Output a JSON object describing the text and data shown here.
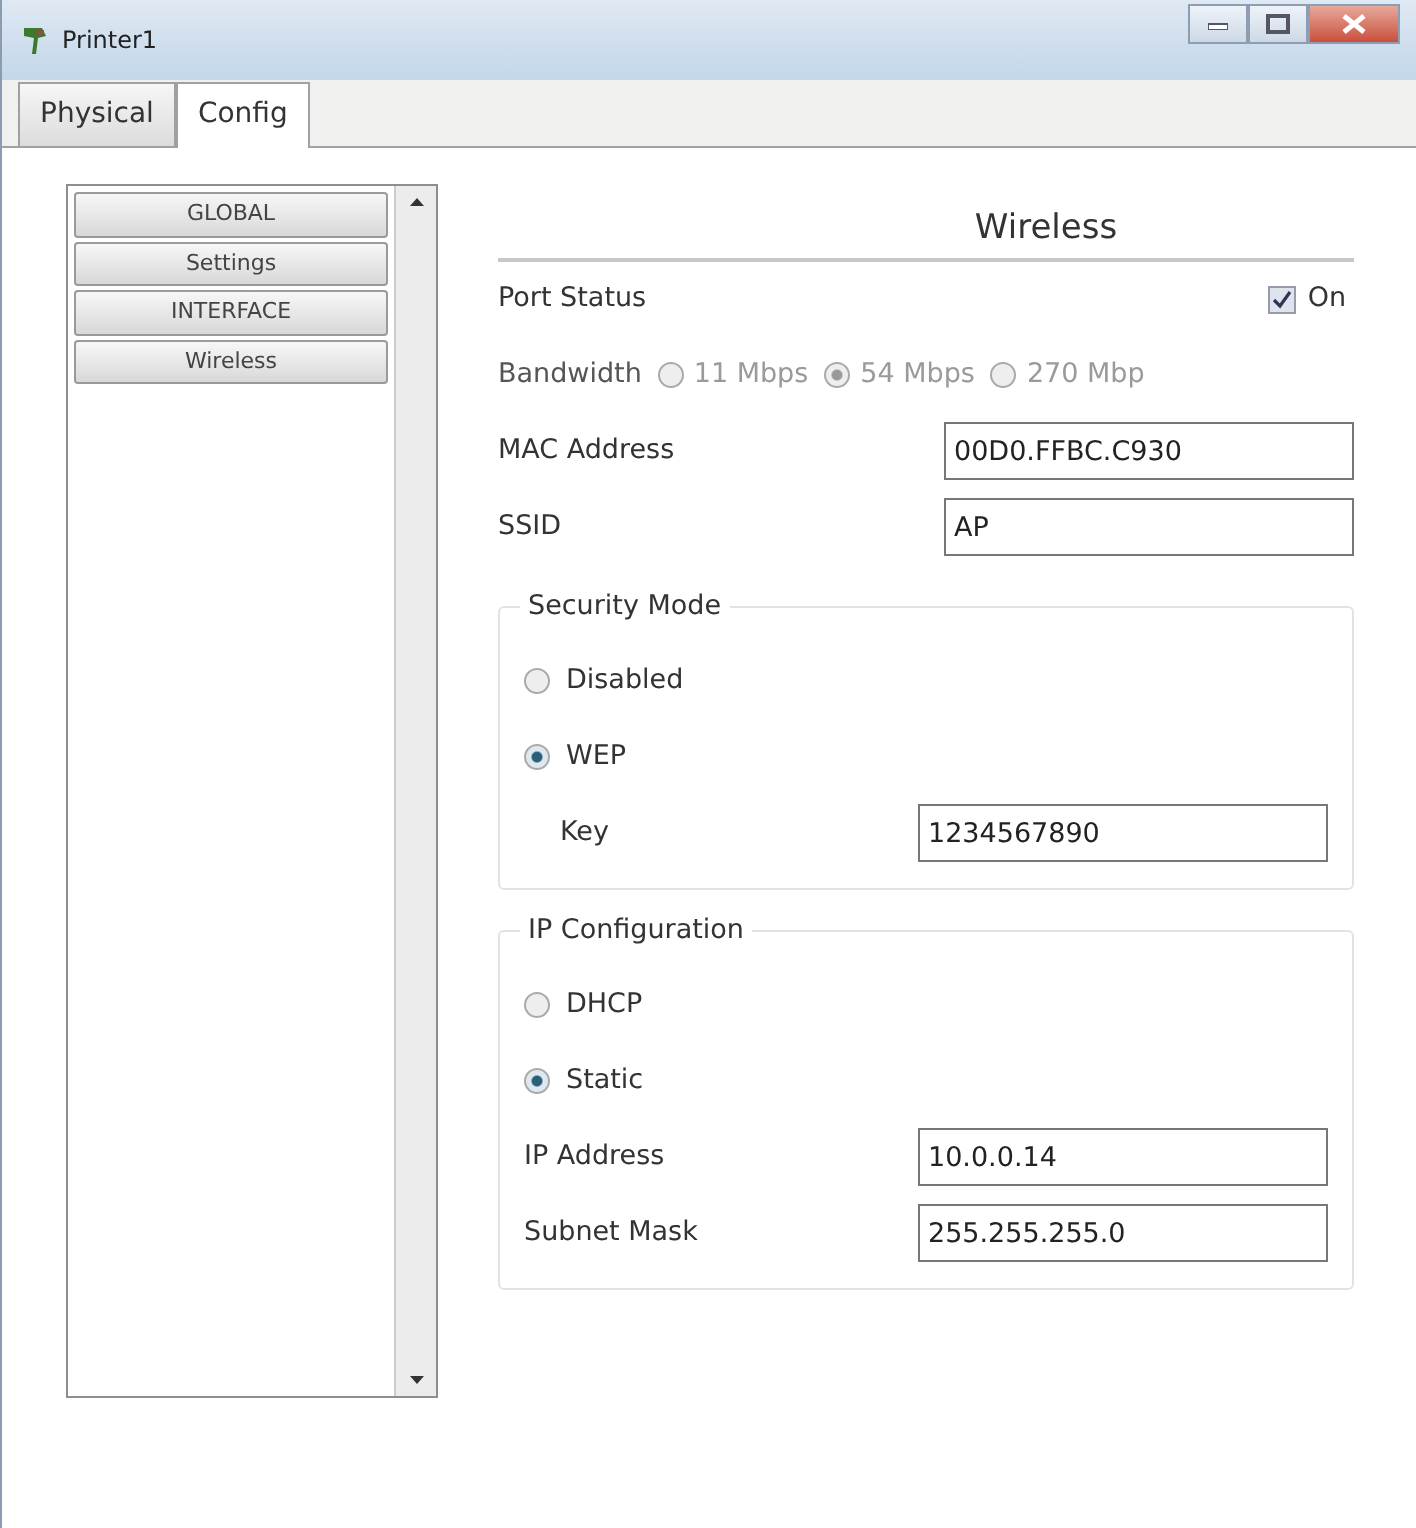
{
  "window": {
    "title": "Printer1"
  },
  "tabs": [
    {
      "label": "Physical",
      "selected": false
    },
    {
      "label": "Config",
      "selected": true
    }
  ],
  "sidebar": {
    "items": [
      {
        "label": "GLOBAL"
      },
      {
        "label": "Settings"
      },
      {
        "label": "INTERFACE"
      },
      {
        "label": "Wireless"
      }
    ]
  },
  "panel": {
    "title": "Wireless",
    "port_status": {
      "label": "Port Status",
      "checkbox_label": "On",
      "checked": true
    },
    "bandwidth": {
      "label": "Bandwidth",
      "disabled": true,
      "options": [
        {
          "label": "11 Mbps",
          "selected": false
        },
        {
          "label": "54 Mbps",
          "selected": true
        },
        {
          "label": "270 Mbp",
          "selected": false
        }
      ]
    },
    "fields": [
      {
        "label": "MAC Address",
        "value": "00D0.FFBC.C930"
      },
      {
        "label": "SSID",
        "value": "AP"
      }
    ],
    "groups": [
      {
        "title": "Security Mode",
        "options": [
          {
            "label": "Disabled",
            "selected": false
          },
          {
            "label": "WEP",
            "selected": true
          }
        ],
        "fields": [
          {
            "label": "Key",
            "value": "1234567890",
            "indent": true
          }
        ]
      },
      {
        "title": "IP Configuration",
        "options": [
          {
            "label": "DHCP",
            "selected": false
          },
          {
            "label": "Static",
            "selected": true
          }
        ],
        "fields": [
          {
            "label": "IP Address",
            "value": "10.0.0.14",
            "indent": false
          },
          {
            "label": "Subnet Mask",
            "value": "255.255.255.0",
            "indent": false
          }
        ]
      }
    ]
  }
}
